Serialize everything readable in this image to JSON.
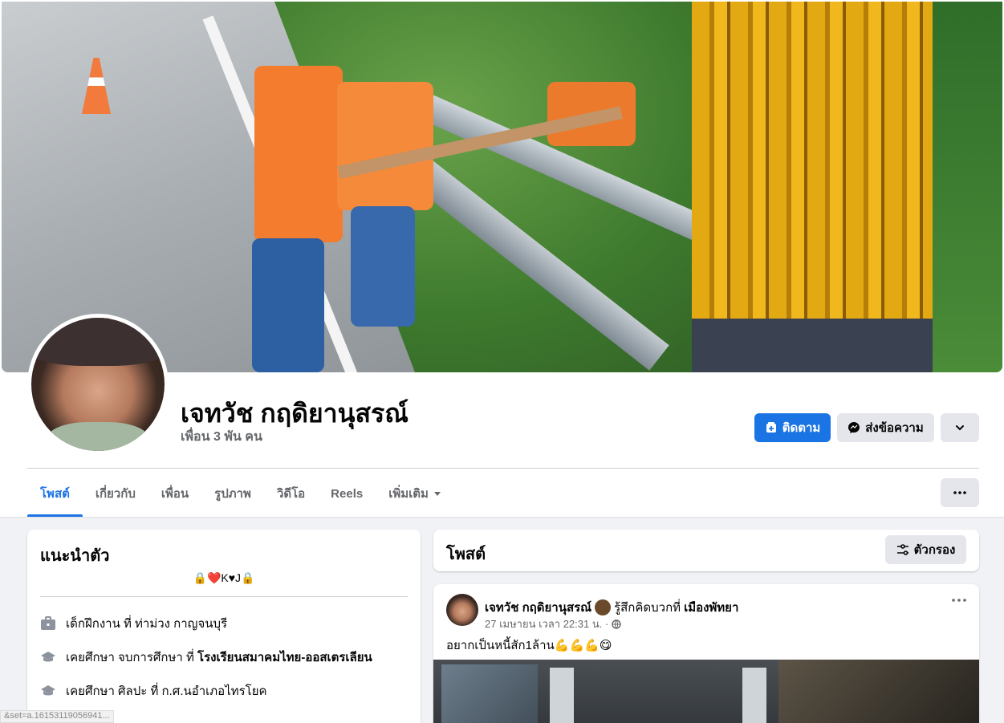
{
  "profile": {
    "name": "เจทวัช กฤดิยานุสรณ์",
    "friends": "เพื่อน 3 พัน คน"
  },
  "actions": {
    "follow": "ติดตาม",
    "message": "ส่งข้อความ"
  },
  "tabs": [
    {
      "label": "โพสต์",
      "active": true
    },
    {
      "label": "เกี่ยวกับ"
    },
    {
      "label": "เพื่อน"
    },
    {
      "label": "รูปภาพ"
    },
    {
      "label": "วิดีโอ"
    },
    {
      "label": "Reels"
    },
    {
      "label": "เพิ่มเติม"
    }
  ],
  "intro": {
    "title": "แนะนำตัว",
    "bio": "🔒❤️K♥J🔒",
    "items": [
      {
        "icon": "briefcase-icon",
        "text": "เด็กฝึกงาน ที่ ท่าม่วง กาญจนบุรี"
      },
      {
        "icon": "graduation-cap-icon",
        "prefix": "เคยศึกษา จบการศึกษา ที่ ",
        "bold": "โรงเรียนสมาคมไทย-ออสเตรเลียน"
      },
      {
        "icon": "graduation-cap-icon",
        "text": "เคยศึกษา ศิลปะ ที่ ก.ศ.นอำเภอไทรโยค"
      }
    ]
  },
  "posts_header": {
    "title": "โพสต์",
    "filter": "ตัวกรอง"
  },
  "post": {
    "author": "เจทวัช กฤดิยานุสรณ์",
    "feeling": "รู้สึกคิดบวกที่",
    "place": "เมืองพัทยา",
    "time": "27 เมษายน เวลา 22:31 น. ·",
    "text": "อยากเป็นหนี้สัก1ล้าน💪💪💪😋"
  },
  "status_bar": {
    "url": "&set=a.16153119056941..."
  },
  "colors": {
    "accent": "#1b74e4",
    "background": "#f0f2f5",
    "secondary_text": "#65676b"
  }
}
